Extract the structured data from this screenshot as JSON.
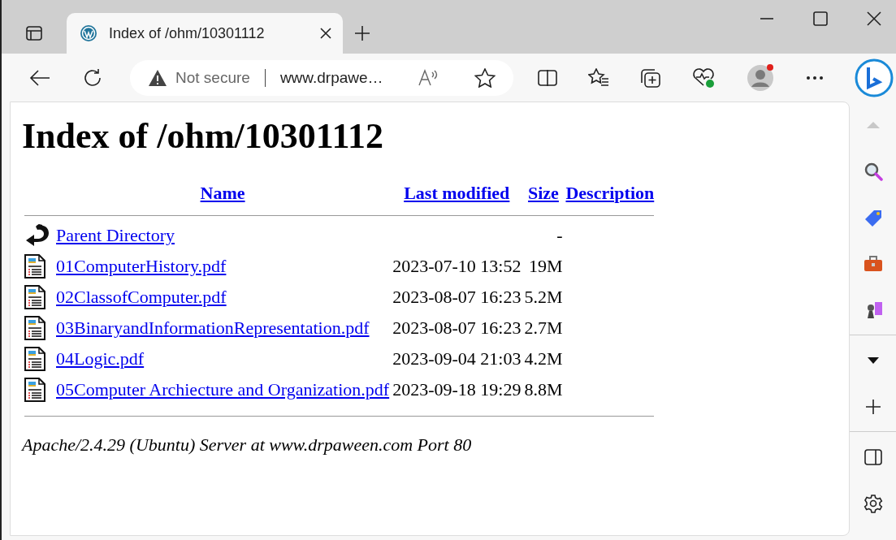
{
  "tabs": [
    {
      "title": "Index of /ohm/10301112",
      "selected": true
    }
  ],
  "address_bar": {
    "security": "Not secure",
    "url": "www.drpawe…"
  },
  "page": {
    "heading": "Index of /ohm/10301112",
    "columns": [
      "Name",
      "Last modified",
      "Size",
      "Description"
    ],
    "rows": [
      {
        "kind": "parent",
        "name": "Parent Directory",
        "modified": "",
        "size": "-"
      },
      {
        "kind": "file",
        "name": "01ComputerHistory.pdf",
        "modified": "2023-07-10 13:52",
        "size": "19M"
      },
      {
        "kind": "file",
        "name": "02ClassofComputer.pdf",
        "modified": "2023-08-07 16:23",
        "size": "5.2M"
      },
      {
        "kind": "file",
        "name": "03BinaryandInformationRepresentation.pdf",
        "modified": "2023-08-07 16:23",
        "size": "2.7M"
      },
      {
        "kind": "file",
        "name": "04Logic.pdf",
        "modified": "2023-09-04 21:03",
        "size": "4.2M"
      },
      {
        "kind": "file",
        "name": "05Computer Archiecture and Organization.pdf",
        "modified": "2023-09-18 19:29",
        "size": "8.8M"
      }
    ],
    "footer": "Apache/2.4.29 (Ubuntu) Server at www.drpaween.com Port 80"
  }
}
